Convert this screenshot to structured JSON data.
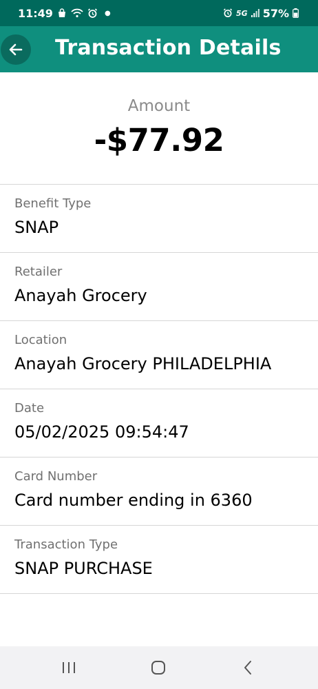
{
  "status_bar": {
    "time": "11:49",
    "network": "5G",
    "battery": "57%",
    "icons_left": [
      "shopping-bag-icon",
      "wifi-calling-icon",
      "alarm-icon",
      "notification-dot"
    ],
    "icons_right": [
      "alarm-icon",
      "network-5g-icon",
      "signal-icon",
      "battery-icon"
    ]
  },
  "app_bar": {
    "title": "Transaction Details",
    "back_icon": "arrow-left-icon"
  },
  "amount": {
    "label": "Amount",
    "value": "-$77.92"
  },
  "details": [
    {
      "label": "Benefit Type",
      "value": "SNAP"
    },
    {
      "label": "Retailer",
      "value": "Anayah Grocery"
    },
    {
      "label": "Location",
      "value": "Anayah Grocery PHILADELPHIA"
    },
    {
      "label": "Date",
      "value": "05/02/2025 09:54:47"
    },
    {
      "label": "Card Number",
      "value": "Card number ending in 6360"
    },
    {
      "label": "Transaction Type",
      "value": "SNAP PURCHASE"
    }
  ],
  "nav_bar": {
    "buttons": [
      "recent-apps-icon",
      "home-icon",
      "back-icon"
    ]
  },
  "colors": {
    "status_bar": "#00695c",
    "app_bar": "#0f8f7e",
    "back_button_bg": "#0a6b5e",
    "label_text": "#707070",
    "divider": "#d6d6d6",
    "nav_bar": "#f2f2f4"
  }
}
